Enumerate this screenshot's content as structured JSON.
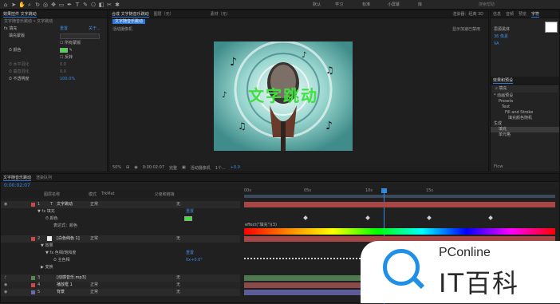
{
  "toolbar": {
    "workspaces": [
      "默认",
      "学习",
      "标准",
      "小屏幕",
      "库"
    ],
    "search_placeholder": "搜索帮助"
  },
  "effects_panel": {
    "tab_title": "效果控件 文字跳动",
    "path": "文字随音乐跳动 • 文字跳动",
    "effect_name": "填充",
    "reset": "重置",
    "about": "关于...",
    "rows": [
      {
        "label": "填充蒙版",
        "value": ""
      },
      {
        "label": "",
        "value": "所有蒙版"
      },
      {
        "label": "颜色",
        "value": ""
      },
      {
        "label": "",
        "value": "反转"
      },
      {
        "label": "水平羽化",
        "value": "0.0"
      },
      {
        "label": "垂直羽化",
        "value": "0.0"
      },
      {
        "label": "不透明度",
        "value": "100.0%"
      }
    ]
  },
  "composition": {
    "tab_title": "合成 文字随音乐跳动",
    "layer_tab": "图层（无）",
    "footage_tab": "素材（无）",
    "comp_name": "文字随音乐跳动",
    "renderer": "渲染器：经典 3D",
    "camera": "活动摄像机",
    "draft_hint": "显示加速已禁用",
    "title_text": "文字跳动",
    "controls": {
      "zoom": "50%",
      "timecode": "0:00:02:07",
      "resolution": "完整",
      "camera_sel": "活动摄像机",
      "views": "1个...",
      "exposure": "+0.0"
    }
  },
  "right_panel": {
    "tabs": [
      "信息",
      "音频",
      "预览",
      "字符"
    ],
    "font": "思源黑体",
    "size": "36 像素",
    "effects_tab": "效果和预设",
    "search_value": "填充",
    "tree": [
      "* 动画预设",
      "Presets",
      "Text",
      "Fill and Stroke",
      "填充颜色随机",
      "生成",
      "填充",
      "单元格"
    ],
    "bottom_tab": "Flow"
  },
  "timeline": {
    "tab_title": "文字随音乐跳动",
    "render_queue": "渲染队列",
    "timecode": "0:00:02:07",
    "col_name": "图层名称",
    "col_mode": "模式",
    "col_trkmat": "TrkMat",
    "col_parent": "父级和链接",
    "markers": [
      "00s",
      "05s",
      "10s",
      "15s"
    ],
    "layers": [
      {
        "num": "1",
        "name": "文字跳动",
        "mode": "正常",
        "parent": "无",
        "color": "#c94a4a"
      },
      {
        "num": "",
        "name": "填充",
        "mode": "",
        "parent": "",
        "color": ""
      },
      {
        "num": "",
        "name": "颜色",
        "mode": "",
        "parent": "",
        "color": ""
      },
      {
        "num": "",
        "name": "表达式：颜色",
        "mode": "",
        "parent": "",
        "color": ""
      },
      {
        "num": "2",
        "name": "[白色纯色 1]",
        "mode": "正常",
        "parent": "无",
        "color": "#c94a4a"
      },
      {
        "num": "",
        "name": "效果",
        "mode": "",
        "parent": "",
        "color": ""
      },
      {
        "num": "",
        "name": "色相/饱和度",
        "mode": "",
        "parent": "",
        "color": ""
      },
      {
        "num": "",
        "name": "主色相",
        "mode": "",
        "parent": "",
        "color": ""
      },
      {
        "num": "",
        "name": "变换",
        "mode": "",
        "parent": "",
        "color": ""
      },
      {
        "num": "3",
        "name": "[动感音乐.mp3]",
        "mode": "",
        "parent": "无",
        "color": "#4f8a4f"
      },
      {
        "num": "4",
        "name": "播放框 1",
        "mode": "正常",
        "parent": "无",
        "color": "#c94a4a"
      },
      {
        "num": "5",
        "name": "背景",
        "mode": "正常",
        "parent": "无",
        "color": "#6a6ab0"
      }
    ],
    "expression": "effect(\"填充\")(3)",
    "hue_value": "0x+0.0°",
    "reset": "重置"
  },
  "watermark": {
    "brand": "PConline",
    "site": "IT百科"
  }
}
